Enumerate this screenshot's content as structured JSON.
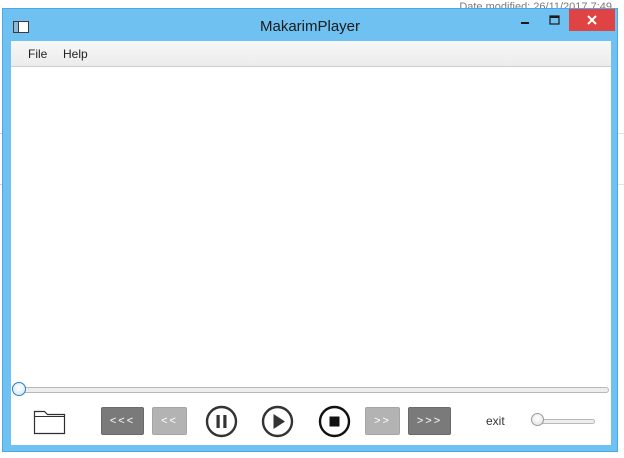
{
  "background_window": {
    "detail_text": "Date modified: 26/11/2017 7:49"
  },
  "window": {
    "title": "MakarimPlayer",
    "app_icon": "window-app-icon",
    "controls": {
      "minimize_icon": "minimize-icon",
      "maximize_icon": "maximize-icon",
      "close_icon": "close-icon"
    }
  },
  "menubar": {
    "items": [
      "File",
      "Help"
    ]
  },
  "playback": {
    "seek_position": 0,
    "folder_icon": "folder-icon",
    "buttons": {
      "skip_back_far": "<<<",
      "skip_back": "<<",
      "pause_icon": "pause-icon",
      "play_icon": "play-icon",
      "stop_icon": "stop-icon",
      "skip_forward": ">>",
      "skip_forward_far": ">>>"
    },
    "exit_label": "exit",
    "volume_level": 0
  },
  "colors": {
    "titlebar": "#6ec1f0",
    "close_button": "#e04343",
    "dark_button": "#7a7a7a",
    "light_button": "#b3b3b3",
    "seek_thumb_border": "#2e7fc0"
  }
}
